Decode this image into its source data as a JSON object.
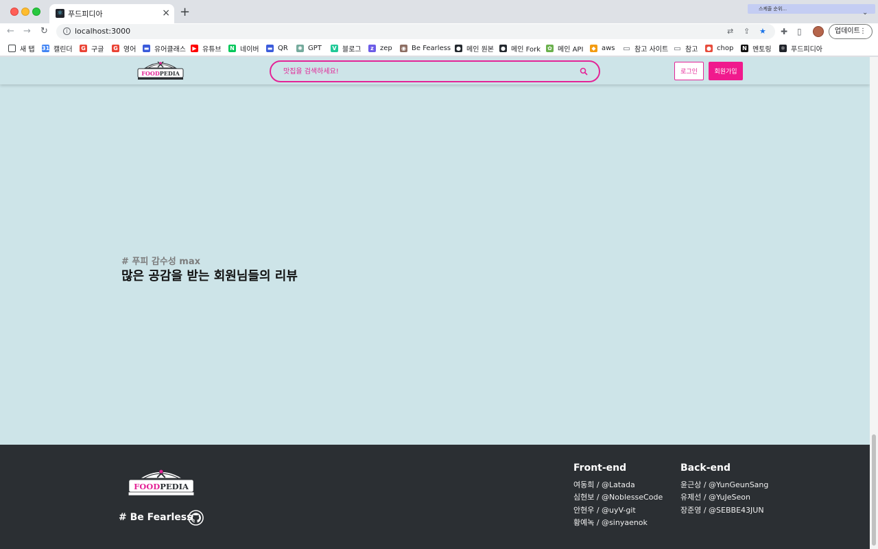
{
  "browser": {
    "tab_title": "푸드피디아",
    "tab_favicon": "react-icon",
    "new_tab": "+",
    "tab_close": "×",
    "profile_chip": "스케줄 순위...",
    "url": "localhost:3000",
    "update_label": "업데이트",
    "bookmarks": [
      {
        "label": "새 탭",
        "icon": "page-icon",
        "color": "#ffffff"
      },
      {
        "label": "캘린더",
        "icon": "calendar-icon",
        "color": "#4285f4"
      },
      {
        "label": "구글",
        "icon": "google-icon",
        "color": "#ea4335"
      },
      {
        "label": "영어",
        "icon": "google-icon",
        "color": "#ea4335"
      },
      {
        "label": "유어클래스",
        "icon": "class-icon",
        "color": "#3b5bdb"
      },
      {
        "label": "유튜브",
        "icon": "youtube-icon",
        "color": "#ff0000"
      },
      {
        "label": "네이버",
        "icon": "naver-icon",
        "color": "#03c75a"
      },
      {
        "label": "QR",
        "icon": "qr-icon",
        "color": "#3b5bdb"
      },
      {
        "label": "GPT",
        "icon": "gpt-icon",
        "color": "#74aa9c"
      },
      {
        "label": "블로그",
        "icon": "velog-icon",
        "color": "#20c997"
      },
      {
        "label": "zep",
        "icon": "zep-icon",
        "color": "#6c5ce7"
      },
      {
        "label": "Be Fearless",
        "icon": "eye-icon",
        "color": "#8d6e63"
      },
      {
        "label": "메인 원본",
        "icon": "github-icon",
        "color": "#24292f"
      },
      {
        "label": "메인 Fork",
        "icon": "github-icon",
        "color": "#24292f"
      },
      {
        "label": "메인 API",
        "icon": "leaf-icon",
        "color": "#6ab04c"
      },
      {
        "label": "aws",
        "icon": "aws-icon",
        "color": "#f39c12"
      },
      {
        "label": "참고 사이트",
        "icon": "folder-icon",
        "color": "#5f6368"
      },
      {
        "label": "참고",
        "icon": "folder-icon",
        "color": "#5f6368"
      },
      {
        "label": "chop",
        "icon": "apple-icon",
        "color": "#e74c3c"
      },
      {
        "label": "멘토링",
        "icon": "notion-icon",
        "color": "#111111"
      },
      {
        "label": "푸드피디아",
        "icon": "react-icon",
        "color": "#20232a"
      }
    ]
  },
  "site": {
    "logo_text": "FOODPEDIA",
    "logo_food": "FOOD",
    "logo_pedia": "PEDIA",
    "search_placeholder": "맛집을 검색하세요!",
    "login_label": "로그인",
    "signup_label": "회원가입",
    "accent_color": "#e32396",
    "background_color": "#cde4e8"
  },
  "review_section": {
    "tag": "# 푸피 감수성 max",
    "title": "많은 공감을 받는 회원님들의 리뷰"
  },
  "footer": {
    "slogan": "# Be Fearless",
    "frontend": {
      "heading": "Front-end",
      "members": [
        "여동희 / @Latada",
        "심현보 / @NoblesseCode",
        "안현우 / @uyV-git",
        "황예녹 / @sinyaenok"
      ]
    },
    "backend": {
      "heading": "Back-end",
      "members": [
        "윤근상 / @YunGeunSang",
        "유제선 / @YuJeSeon",
        "장준영 / @SEBBE43JUN"
      ]
    }
  }
}
